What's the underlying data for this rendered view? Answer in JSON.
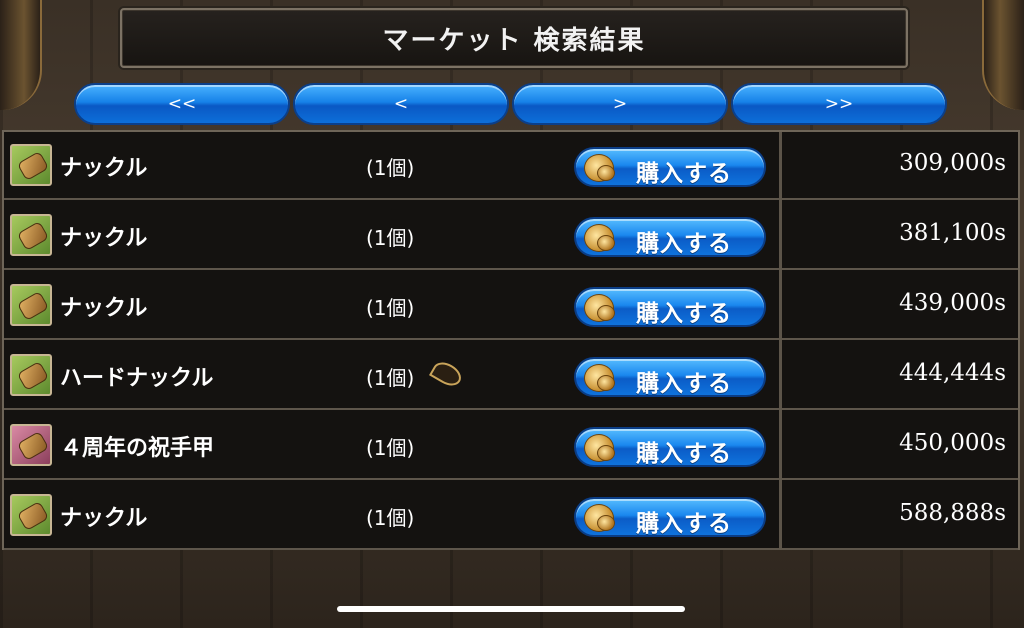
{
  "title": "マーケット 検索結果",
  "nav": [
    {
      "label": "<<"
    },
    {
      "label": "<"
    },
    {
      "label": ">"
    },
    {
      "label": ">>"
    }
  ],
  "rows": [
    {
      "name": "ナックル",
      "qty": "(1個)",
      "buy": "購入する",
      "price": "309,000s",
      "icon": "knuckle-icon"
    },
    {
      "name": "ナックル",
      "qty": "(1個)",
      "buy": "購入する",
      "price": "381,100s",
      "icon": "knuckle-icon"
    },
    {
      "name": "ナックル",
      "qty": "(1個)",
      "buy": "購入する",
      "price": "439,000s",
      "icon": "knuckle-icon"
    },
    {
      "name": "ハードナックル",
      "qty": "(1個)",
      "buy": "購入する",
      "price": "444,444s",
      "icon": "knuckle-icon"
    },
    {
      "name": "４周年の祝手甲",
      "qty": "(1個)",
      "buy": "購入する",
      "price": "450,000s",
      "icon": "gauntlet-icon"
    },
    {
      "name": "ナックル",
      "qty": "(1個)",
      "buy": "購入する",
      "price": "588,888s",
      "icon": "knuckle-icon"
    }
  ]
}
